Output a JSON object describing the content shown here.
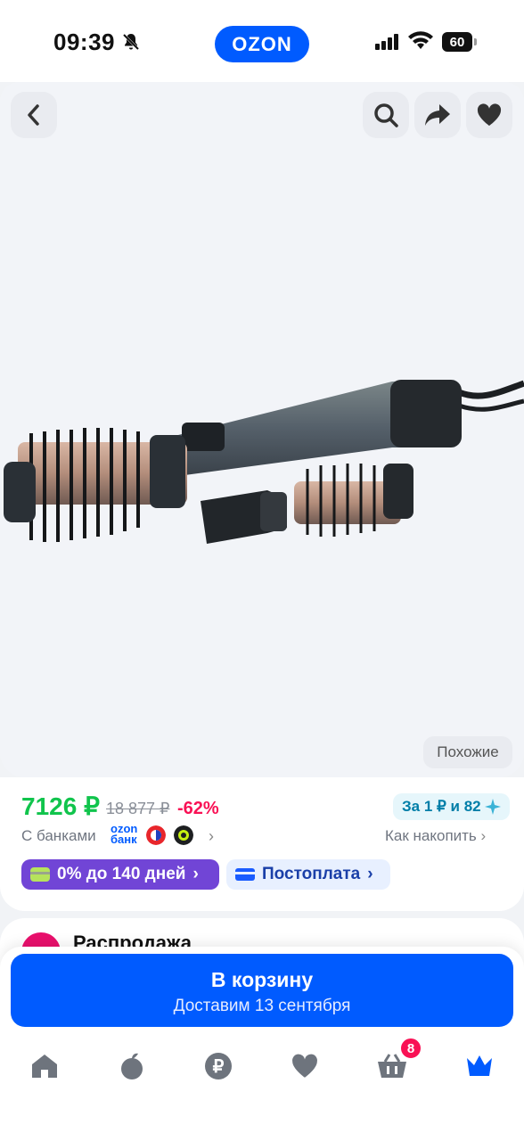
{
  "status_bar": {
    "time": "09:39",
    "battery": "60",
    "logo": "OZON"
  },
  "product": {
    "similar_label": "Похожие"
  },
  "price": {
    "current": "7126 ₽",
    "old": "18 877 ₽",
    "discount": "-62%",
    "points": "За 1 ₽ и 82",
    "banks_label": "С банками",
    "ozon_bank_line1": "ozon",
    "ozon_bank_line2": "банк",
    "accumulate_label": "Как накопить"
  },
  "payment": {
    "installment": "0% до 140 дней",
    "postpay": "Постоплата"
  },
  "seller": {
    "name": "Распродажа"
  },
  "cart": {
    "title": "В корзину",
    "subtitle": "Доставим 13 сентября"
  },
  "nav": {
    "cart_count": "8"
  },
  "colors": {
    "brand": "#005bff",
    "price_green": "#10c44c",
    "discount_red": "#f91155",
    "installment_purple": "#7145d6"
  }
}
